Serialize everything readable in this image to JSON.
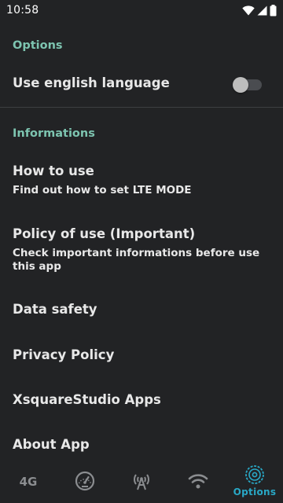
{
  "status_bar": {
    "time": "10:58"
  },
  "options_section": {
    "header": "Options",
    "language_label": "Use english language",
    "language_toggle_on": false
  },
  "info_section": {
    "header": "Informations",
    "items": [
      {
        "title": "How to use",
        "subtitle": "Find out how to set LTE MODE"
      },
      {
        "title": "Policy of use (Important)",
        "subtitle": "Check important informations before use this app"
      },
      {
        "title": "Data safety"
      },
      {
        "title": "Privacy Policy"
      },
      {
        "title": "XsquareStudio Apps"
      },
      {
        "title": "About App"
      }
    ]
  },
  "bottom_nav": {
    "items": [
      {
        "label": "4G",
        "icon": "4g-text"
      },
      {
        "icon": "speedometer-icon"
      },
      {
        "icon": "signal-tower-icon"
      },
      {
        "icon": "wifi-icon"
      },
      {
        "label": "Options",
        "icon": "options-gear-icon",
        "active": true
      }
    ]
  },
  "colors": {
    "background": "#222325",
    "accent": "#7dc4b0",
    "active_nav": "#29a8c6",
    "inactive_nav": "#8b8d90"
  }
}
